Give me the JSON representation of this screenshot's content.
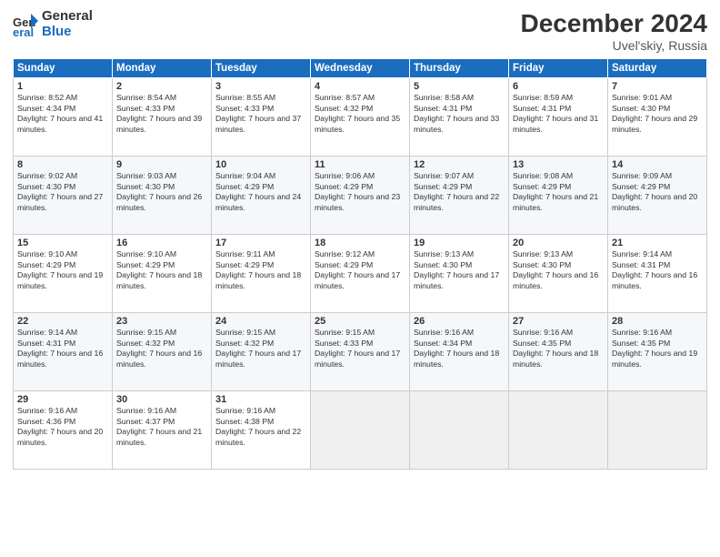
{
  "header": {
    "logo_line1": "General",
    "logo_line2": "Blue",
    "month": "December 2024",
    "location": "Uvel'skiy, Russia"
  },
  "weekdays": [
    "Sunday",
    "Monday",
    "Tuesday",
    "Wednesday",
    "Thursday",
    "Friday",
    "Saturday"
  ],
  "weeks": [
    [
      {
        "day": "1",
        "rise": "8:52 AM",
        "set": "4:34 PM",
        "daylight": "7 hours and 41 minutes."
      },
      {
        "day": "2",
        "rise": "8:54 AM",
        "set": "4:33 PM",
        "daylight": "7 hours and 39 minutes."
      },
      {
        "day": "3",
        "rise": "8:55 AM",
        "set": "4:33 PM",
        "daylight": "7 hours and 37 minutes."
      },
      {
        "day": "4",
        "rise": "8:57 AM",
        "set": "4:32 PM",
        "daylight": "7 hours and 35 minutes."
      },
      {
        "day": "5",
        "rise": "8:58 AM",
        "set": "4:31 PM",
        "daylight": "7 hours and 33 minutes."
      },
      {
        "day": "6",
        "rise": "8:59 AM",
        "set": "4:31 PM",
        "daylight": "7 hours and 31 minutes."
      },
      {
        "day": "7",
        "rise": "9:01 AM",
        "set": "4:30 PM",
        "daylight": "7 hours and 29 minutes."
      }
    ],
    [
      {
        "day": "8",
        "rise": "9:02 AM",
        "set": "4:30 PM",
        "daylight": "7 hours and 27 minutes."
      },
      {
        "day": "9",
        "rise": "9:03 AM",
        "set": "4:30 PM",
        "daylight": "7 hours and 26 minutes."
      },
      {
        "day": "10",
        "rise": "9:04 AM",
        "set": "4:29 PM",
        "daylight": "7 hours and 24 minutes."
      },
      {
        "day": "11",
        "rise": "9:06 AM",
        "set": "4:29 PM",
        "daylight": "7 hours and 23 minutes."
      },
      {
        "day": "12",
        "rise": "9:07 AM",
        "set": "4:29 PM",
        "daylight": "7 hours and 22 minutes."
      },
      {
        "day": "13",
        "rise": "9:08 AM",
        "set": "4:29 PM",
        "daylight": "7 hours and 21 minutes."
      },
      {
        "day": "14",
        "rise": "9:09 AM",
        "set": "4:29 PM",
        "daylight": "7 hours and 20 minutes."
      }
    ],
    [
      {
        "day": "15",
        "rise": "9:10 AM",
        "set": "4:29 PM",
        "daylight": "7 hours and 19 minutes."
      },
      {
        "day": "16",
        "rise": "9:10 AM",
        "set": "4:29 PM",
        "daylight": "7 hours and 18 minutes."
      },
      {
        "day": "17",
        "rise": "9:11 AM",
        "set": "4:29 PM",
        "daylight": "7 hours and 18 minutes."
      },
      {
        "day": "18",
        "rise": "9:12 AM",
        "set": "4:29 PM",
        "daylight": "7 hours and 17 minutes."
      },
      {
        "day": "19",
        "rise": "9:13 AM",
        "set": "4:30 PM",
        "daylight": "7 hours and 17 minutes."
      },
      {
        "day": "20",
        "rise": "9:13 AM",
        "set": "4:30 PM",
        "daylight": "7 hours and 16 minutes."
      },
      {
        "day": "21",
        "rise": "9:14 AM",
        "set": "4:31 PM",
        "daylight": "7 hours and 16 minutes."
      }
    ],
    [
      {
        "day": "22",
        "rise": "9:14 AM",
        "set": "4:31 PM",
        "daylight": "7 hours and 16 minutes."
      },
      {
        "day": "23",
        "rise": "9:15 AM",
        "set": "4:32 PM",
        "daylight": "7 hours and 16 minutes."
      },
      {
        "day": "24",
        "rise": "9:15 AM",
        "set": "4:32 PM",
        "daylight": "7 hours and 17 minutes."
      },
      {
        "day": "25",
        "rise": "9:15 AM",
        "set": "4:33 PM",
        "daylight": "7 hours and 17 minutes."
      },
      {
        "day": "26",
        "rise": "9:16 AM",
        "set": "4:34 PM",
        "daylight": "7 hours and 18 minutes."
      },
      {
        "day": "27",
        "rise": "9:16 AM",
        "set": "4:35 PM",
        "daylight": "7 hours and 18 minutes."
      },
      {
        "day": "28",
        "rise": "9:16 AM",
        "set": "4:35 PM",
        "daylight": "7 hours and 19 minutes."
      }
    ],
    [
      {
        "day": "29",
        "rise": "9:16 AM",
        "set": "4:36 PM",
        "daylight": "7 hours and 20 minutes."
      },
      {
        "day": "30",
        "rise": "9:16 AM",
        "set": "4:37 PM",
        "daylight": "7 hours and 21 minutes."
      },
      {
        "day": "31",
        "rise": "9:16 AM",
        "set": "4:38 PM",
        "daylight": "7 hours and 22 minutes."
      },
      null,
      null,
      null,
      null
    ]
  ]
}
